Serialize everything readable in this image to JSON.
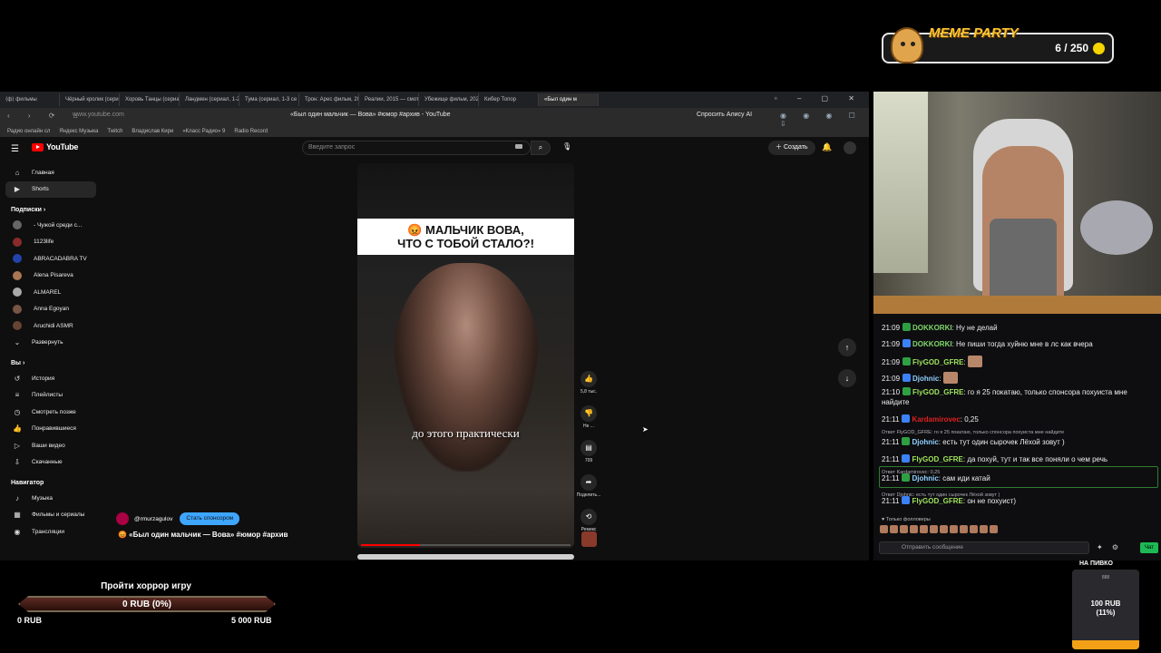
{
  "meme_party": {
    "title": "MEME PARTY",
    "count": "6 / 250"
  },
  "browser": {
    "tabs": [
      "⟨ф⟩ фильмы",
      "Чёрный кролик (сери",
      "Хоровь Танцы (сериа",
      "Ландмен (сериал, 1-2",
      "Тумa (сериал, 1-3 се",
      "Трон: Арес фильм, 20",
      "Реалии, 2015 — смотр",
      "Убежище фильм, 2025",
      "Кибер Топор",
      "«Был один м"
    ],
    "active_tab_index": 9,
    "url": "www.youtube.com",
    "document_title": "«Был один мальчик — Вова» #юмор #архив - YouTube",
    "alice_button": "Спросить Алису AI",
    "bookmarks": [
      "Радио онлайн сл",
      "Яндекс Музыка",
      "Twitch",
      "Владислав Кири",
      "«Класс Радио» 9",
      "Radio Record"
    ]
  },
  "youtube": {
    "logo_text": "YouTube",
    "search_placeholder": "Введите запрос",
    "create_label": "Создать",
    "nav": [
      {
        "label": "Главная",
        "icon": "home-icon",
        "selected": false
      },
      {
        "label": "Shorts",
        "icon": "shorts-icon",
        "selected": true
      }
    ],
    "subs_header": "Подписки",
    "subs": [
      {
        "label": "- Чужой среди с...",
        "color": "#666"
      },
      {
        "label": "1123life",
        "color": "#8a2a2a"
      },
      {
        "label": "ABRACADABRA TV",
        "color": "#2244aa"
      },
      {
        "label": "Alena Pisareva",
        "color": "#aa7755"
      },
      {
        "label": "ALMAREL",
        "color": "#aaaaaa"
      },
      {
        "label": "Anna Egoyan",
        "color": "#775544"
      },
      {
        "label": "Aruchidi ASMR",
        "color": "#664433"
      }
    ],
    "expand_label": "Развернуть",
    "you_header": "Вы",
    "you_items": [
      {
        "label": "История",
        "icon": "history-icon"
      },
      {
        "label": "Плейлисты",
        "icon": "playlists-icon"
      },
      {
        "label": "Смотреть позже",
        "icon": "watch-later-icon"
      },
      {
        "label": "Понравившиеся",
        "icon": "like-icon"
      },
      {
        "label": "Ваши видео",
        "icon": "your-videos-icon"
      },
      {
        "label": "Скачанные",
        "icon": "downloads-icon"
      }
    ],
    "navigator_header": "Навигатор",
    "navigator_items": [
      {
        "label": "Музыка",
        "icon": "music-icon"
      },
      {
        "label": "Фильмы и сериалы",
        "icon": "films-icon"
      },
      {
        "label": "Трансляции",
        "icon": "live-icon"
      }
    ],
    "video": {
      "banner_line1": "😡 МАЛЬЧИК ВОВА,",
      "banner_line2": "ЧТО С ТОБОЙ СТАЛО?!",
      "caption": "до этого практически",
      "progress": 0.28
    },
    "actions": {
      "likes": "5,8 тыс.",
      "dislike": "Не ...",
      "comments": "709",
      "share": "Поделить...",
      "remix": "Ремикс"
    },
    "channel": {
      "handle": "@rmurzagulov",
      "sponsor_label": "Стать спонсором"
    },
    "video_title": "😡 «Был один мальчик — Вова» #юмор #архив"
  },
  "chat": {
    "messages": [
      {
        "time": "21:09",
        "user": "DOKKORKI",
        "color": "#7fd86b",
        "text": ": Ну не делай"
      },
      {
        "time": "21:09",
        "user": "DOKKORKI",
        "color": "#7fd86b",
        "text": ": Не пиши тогда хуйню мне в лс как вчера"
      },
      {
        "time": "21:09",
        "user": "FlyGOD_GFRE",
        "color": "#9fe35c",
        "text": ":"
      },
      {
        "time": "21:09",
        "user": "Djohnic",
        "color": "#8fd0ff",
        "text": ":"
      },
      {
        "time": "21:10",
        "user": "FlyGOD_GFRE",
        "color": "#9fe35c",
        "text": ": го я 25 покатаю, только спонсора похуиста мне найдите"
      },
      {
        "time": "21:11",
        "user": "Kardamirovec",
        "color": "#e02020",
        "text": ": 0,25"
      },
      {
        "time": "21:11",
        "user": "Djohnic",
        "color": "#8fd0ff",
        "text": ": есть тут один сырочек Лёхой зовут )"
      },
      {
        "time": "21:11",
        "user": "FlyGOD_GFRE",
        "color": "#9fe35c",
        "text": ": да похуй, тут и так все поняли о чем речь"
      },
      {
        "time": "21:11",
        "user": "Djohnic",
        "color": "#8fd0ff",
        "text": ": сам иди катай"
      },
      {
        "time": "21:11",
        "user": "FlyGOD_GFRE",
        "color": "#9fe35c",
        "text": ": он не похуист)"
      }
    ],
    "replies": [
      "Ответ FlyGOD_GFRE: го я 25 покатаю, только спонсора похуиста мне найдите",
      "Ответ Kardamirovec: 0,25",
      "Ответ Djohnic: есть тут один сырочек Лёхой зовут )"
    ],
    "followers_only": "Только фолловеры",
    "input_placeholder": "Отправить сообщение",
    "send_label": "Чат"
  },
  "donation_goal": {
    "title": "Пройти хоррор игру",
    "current": "0 RUB (0%)",
    "progress": 0,
    "min": "0 RUB",
    "max": "5 000 RUB"
  },
  "beer": {
    "label": "НА ПИВКО",
    "small": "888",
    "amount_line1": "100 RUB",
    "amount_line2": "(11%)",
    "progress": 0.11
  }
}
